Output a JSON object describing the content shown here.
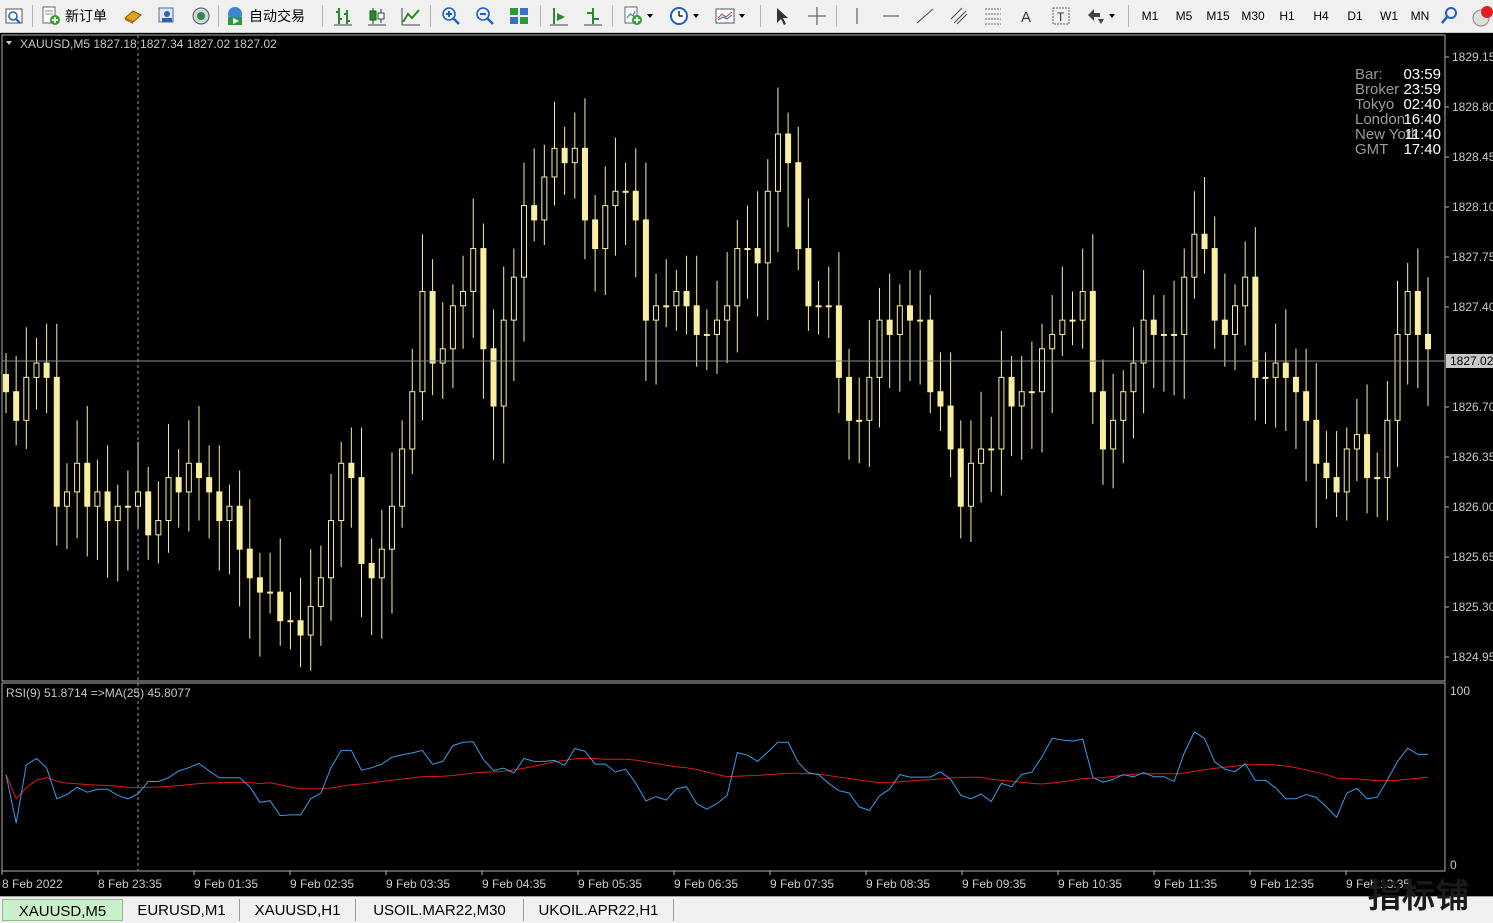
{
  "toolbar": {
    "new_order_label": "新订单",
    "auto_trading_label": "自动交易",
    "timeframes": [
      "M1",
      "M5",
      "M15",
      "M30",
      "H1",
      "H4",
      "D1",
      "W1",
      "MN"
    ]
  },
  "chart": {
    "header": "XAUUSD,M5  1827.18 1827.34 1827.02 1827.02",
    "price_labels": [
      "1829.15",
      "1828.80",
      "1828.45",
      "1828.10",
      "1827.75",
      "1827.40",
      "1827.02",
      "1826.70",
      "1826.35",
      "1826.00",
      "1825.65",
      "1825.30",
      "1824.95"
    ],
    "current_price": "1827.02",
    "time_labels": [
      "8 Feb 2022",
      "8 Feb 23:35",
      "9 Feb 01:35",
      "9 Feb 02:35",
      "9 Feb 03:35",
      "9 Feb 04:35",
      "9 Feb 05:35",
      "9 Feb 06:35",
      "9 Feb 07:35",
      "9 Feb 08:35",
      "9 Feb 09:35",
      "9 Feb 10:35",
      "9 Feb 11:35",
      "9 Feb 12:35",
      "9 Feb 13:35"
    ],
    "rsi_header": "RSI(9) 51.8714  =>MA(25) 45.8077",
    "rsi_scale": [
      "100",
      "0"
    ],
    "colors": {
      "background": "#000000",
      "candle": "#f8f0a0",
      "rsi": "#3a9ce8",
      "ma": "#e01818",
      "grid_text": "#c8c8c8"
    }
  },
  "clock": [
    {
      "name": "Bar:",
      "time": "03:59"
    },
    {
      "name": "Broker",
      "time": "23:59"
    },
    {
      "name": "Tokyo",
      "time": "02:40"
    },
    {
      "name": "London",
      "time": "16:40"
    },
    {
      "name": "New York",
      "time": "11:40"
    },
    {
      "name": "GMT",
      "time": "17:40"
    }
  ],
  "tabs": [
    "XAUUSD,M5",
    "EURUSD,M1",
    "XAUUSD,H1",
    "USOIL.MAR22,M30",
    "UKOIL.APR22,H1"
  ],
  "active_tab": "XAUUSD,M5",
  "watermark": "指标铺",
  "chart_data": {
    "type": "candlestick",
    "symbol": "XAUUSD",
    "timeframe": "M5",
    "ylim": [
      1824.8,
      1829.25
    ],
    "series": [
      {
        "name": "XAUUSD,M5",
        "ohlc_close": [
          1826.8,
          1826.6,
          1826.9,
          1827.0,
          1826.9,
          1826.0,
          1826.1,
          1826.3,
          1826.0,
          1826.1,
          1825.9,
          1826.0,
          1826.0,
          1826.1,
          1825.8,
          1825.9,
          1826.2,
          1826.1,
          1826.3,
          1826.2,
          1826.1,
          1825.9,
          1826.0,
          1825.7,
          1825.5,
          1825.4,
          1825.4,
          1825.2,
          1825.2,
          1825.1,
          1825.3,
          1825.5,
          1825.9,
          1826.3,
          1826.2,
          1825.6,
          1825.5,
          1825.7,
          1826.0,
          1826.4,
          1826.8,
          1827.5,
          1827.0,
          1827.1,
          1827.4,
          1827.5,
          1827.8,
          1827.1,
          1826.7,
          1827.3,
          1827.6,
          1828.1,
          1828.0,
          1828.3,
          1828.5,
          1828.4,
          1828.5,
          1828.0,
          1827.8,
          1828.1,
          1828.2,
          1828.2,
          1828.0,
          1827.3,
          1827.4,
          1827.4,
          1827.5,
          1827.4,
          1827.2,
          1827.2,
          1827.3,
          1827.4,
          1827.8,
          1827.8,
          1827.7,
          1828.2,
          1828.6,
          1828.4,
          1827.8,
          1827.4,
          1827.4,
          1827.4,
          1826.9,
          1826.6,
          1826.6,
          1826.9,
          1827.3,
          1827.2,
          1827.4,
          1827.3,
          1827.3,
          1826.8,
          1826.7,
          1826.4,
          1826.0,
          1826.3,
          1826.4,
          1826.4,
          1826.9,
          1826.7,
          1826.8,
          1826.8,
          1827.1,
          1827.2,
          1827.3,
          1827.3,
          1827.5,
          1826.8,
          1826.4,
          1826.6,
          1826.8,
          1827.0,
          1827.3,
          1827.2,
          1827.2,
          1827.2,
          1827.6,
          1827.9,
          1827.8,
          1827.3,
          1827.2,
          1827.4,
          1827.6,
          1826.9,
          1826.9,
          1827.0,
          1826.9,
          1826.8,
          1826.6,
          1826.3,
          1826.2,
          1826.1,
          1826.4,
          1826.5,
          1826.2,
          1826.2,
          1826.6,
          1827.2,
          1827.5,
          1827.2,
          1827.1
        ]
      },
      {
        "name": "RSI(9)",
        "current": 51.8714
      },
      {
        "name": "MA(25)",
        "current": 45.8077
      }
    ]
  }
}
